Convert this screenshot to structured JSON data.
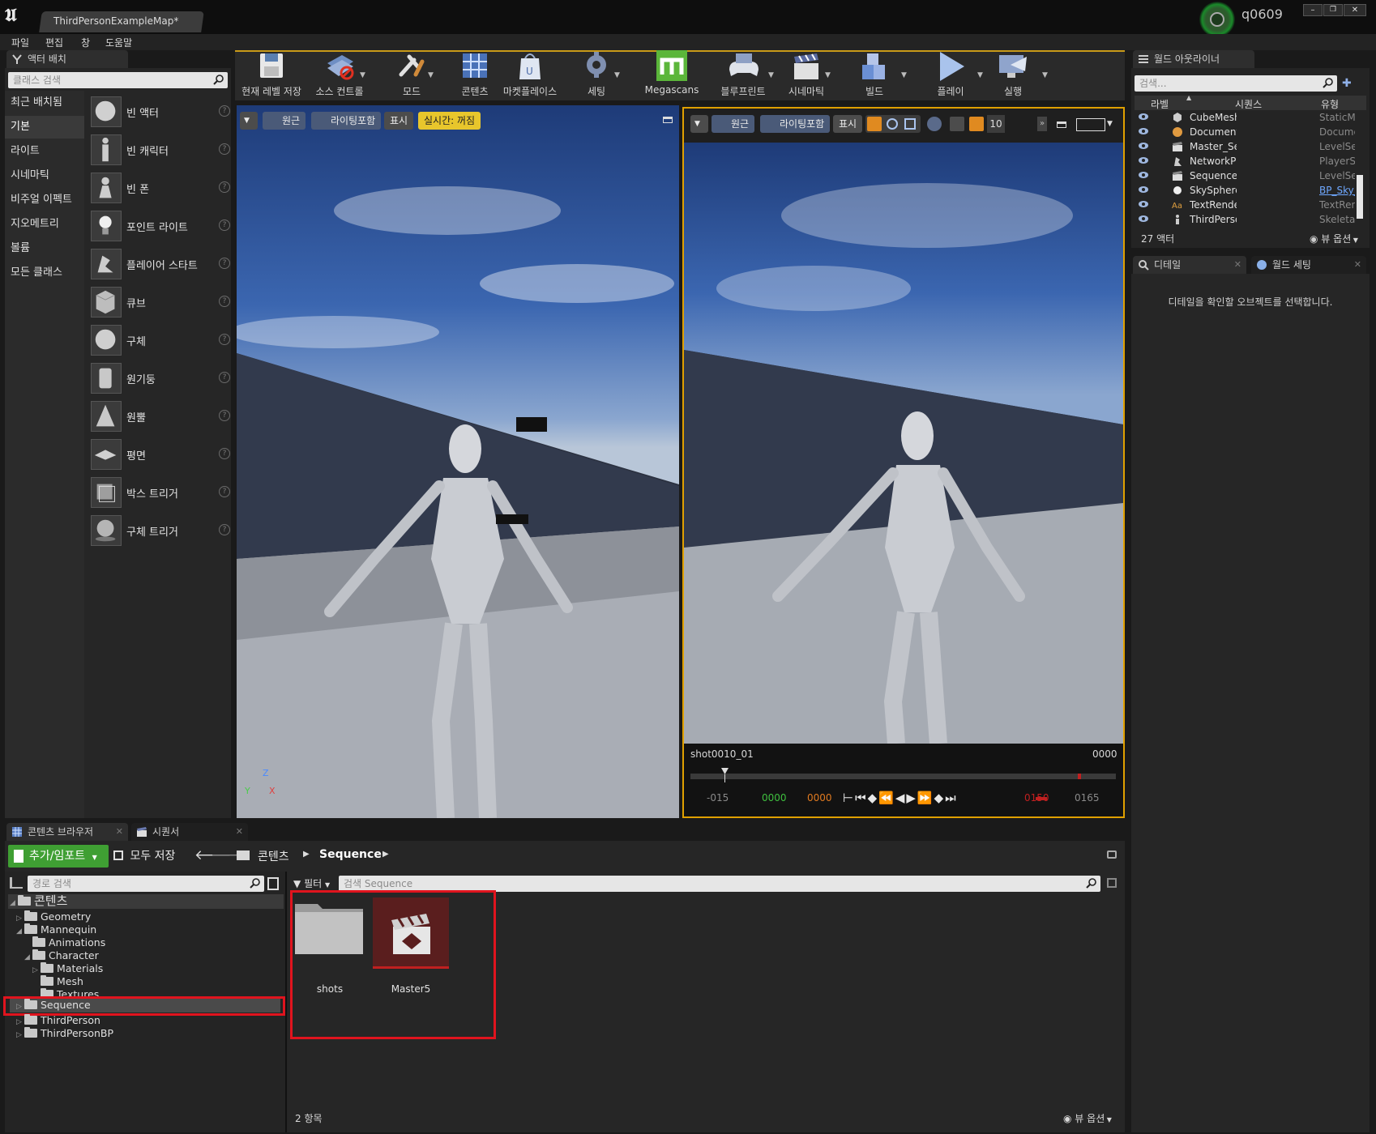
{
  "window": {
    "tab_title": "ThirdPersonExampleMap*",
    "user": "q0609",
    "controls": [
      "–",
      "❐",
      "✕"
    ]
  },
  "menu": [
    "파일",
    "편집",
    "창",
    "도움말"
  ],
  "place_actors": {
    "tab_label": "액터 배치",
    "search_placeholder": "클래스 검색",
    "categories": [
      "최근 배치됨",
      "기본",
      "라이트",
      "시네마틱",
      "비주얼 이펙트",
      "지오메트리",
      "볼륨",
      "모든 클래스"
    ],
    "selected_category": "기본",
    "items": [
      "빈 액터",
      "빈 캐릭터",
      "빈 폰",
      "포인트 라이트",
      "플레이어 스타트",
      "큐브",
      "구체",
      "원기둥",
      "원뿔",
      "평면",
      "박스 트리거",
      "구체 트리거"
    ]
  },
  "toolbar": {
    "buttons": [
      "현재 레벨 저장",
      "소스 컨트롤",
      "모드",
      "콘텐츠",
      "마켓플레이스",
      "세팅",
      "Megascans",
      "블루프린트",
      "시네마틱",
      "빌드",
      "플레이",
      "실행"
    ]
  },
  "viewport_left": {
    "perspective": "원근",
    "lighting": "라이팅포함",
    "show": "표시",
    "realtime": "실시간: 꺼짐",
    "axis_z": "Z",
    "axis_y": "Y",
    "axis_x": "X"
  },
  "viewport_right": {
    "perspective": "원근",
    "lighting": "라이팅포함",
    "show": "표시",
    "grid_size": "10",
    "shot_name": "shot0010_01",
    "current_frame": "0000",
    "timeline": {
      "start": "-015",
      "in_green": "0000",
      "in_orange": "0000",
      "out_red": "0150",
      "end": "0165"
    }
  },
  "outliner": {
    "tab_label": "월드 아웃라이너",
    "search_placeholder": "검색...",
    "columns": [
      "라벨",
      "시퀀스",
      "유형"
    ],
    "rows": [
      {
        "name": "CubeMesh",
        "type": "StaticMeshActor"
      },
      {
        "name": "DocumentationActor",
        "type": "DocumentationActor"
      },
      {
        "name": "Master_Sequence",
        "type": "LevelSequenceActor"
      },
      {
        "name": "NetworkPlayerStart",
        "type": "PlayerStart"
      },
      {
        "name": "Sequence",
        "type": "LevelSequenceActor"
      },
      {
        "name": "SkySphereBlueprint",
        "type": "BP_Sky_Sphere"
      },
      {
        "name": "TextRenderActor",
        "type": "TextRenderActor"
      },
      {
        "name": "ThirdPersonCharacter",
        "type": "SkeletalMeshActor"
      }
    ],
    "count": "27 액터",
    "view_options": "뷰 옵션"
  },
  "details": {
    "tab_details": "디테일",
    "tab_world": "월드 세팅",
    "empty_message": "디테일을 확인할 오브젝트를 선택합니다."
  },
  "content_browser": {
    "tab_label": "콘텐츠 브라우저",
    "tab_sequencer": "시퀀서",
    "add_import": "추가/임포트",
    "save_all": "모두 저장",
    "breadcrumb": [
      "콘텐츠",
      "Sequence"
    ],
    "path_search_placeholder": "경로 검색",
    "filter_label": "필터",
    "asset_search_placeholder": "검색 Sequence",
    "tree": [
      {
        "label": "콘텐츠",
        "depth": 0
      },
      {
        "label": "Geometry",
        "depth": 1
      },
      {
        "label": "Mannequin",
        "depth": 1
      },
      {
        "label": "Animations",
        "depth": 2
      },
      {
        "label": "Character",
        "depth": 2
      },
      {
        "label": "Materials",
        "depth": 3
      },
      {
        "label": "Mesh",
        "depth": 3
      },
      {
        "label": "Textures",
        "depth": 3
      },
      {
        "label": "Sequence",
        "depth": 1
      },
      {
        "label": "ThirdPerson",
        "depth": 1
      },
      {
        "label": "ThirdPersonBP",
        "depth": 1
      }
    ],
    "assets": [
      "shots",
      "Master5"
    ],
    "item_count": "2 항목",
    "view_options": "뷰 옵션"
  },
  "colors": {
    "highlight_red": "#e0141e",
    "megascans_green": "#5bb63a",
    "add_button_green": "#3f9f33",
    "realtime_yellow": "#e8c62c",
    "viewport_border_orange": "#e0a000"
  }
}
